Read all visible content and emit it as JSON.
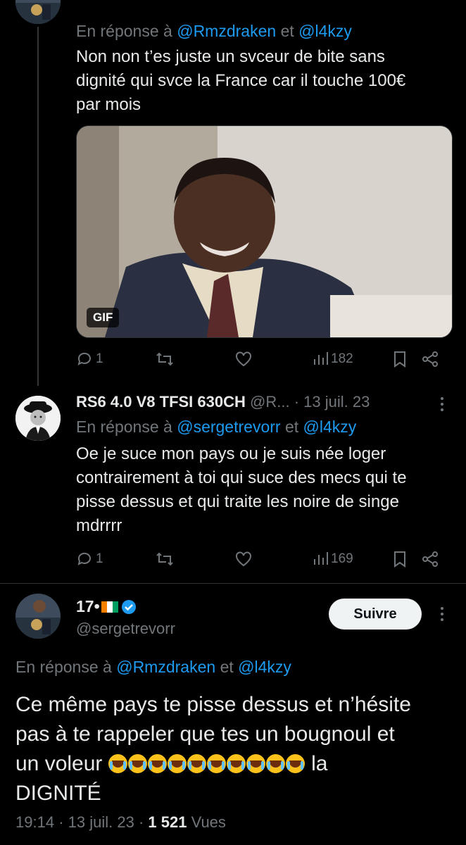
{
  "reply1": {
    "reply_prefix": "En réponse à",
    "mention1": "@Rmzdraken",
    "joiner": "et",
    "mention2": "@l4kzy",
    "text_lines": [
      "Non non t’es juste un svceur de bite sans",
      "dignité qui svce la France car il touche 100€",
      "par mois"
    ],
    "gif_label": "GIF",
    "replies": "1",
    "views": "182"
  },
  "reply2": {
    "name": "RS6 4.0 V8 TFSI 630CH",
    "handle": "@R...",
    "date": "· 13 juil. 23",
    "reply_prefix": "En réponse à",
    "mention1": "@sergetrevorr",
    "joiner": "et",
    "mention2": "@l4kzy",
    "text_lines": [
      "Oe je suce mon pays ou je suis née loger",
      "contrairement à toi qui suce des mecs qui te",
      "pisse dessus et qui traite les noire de singe",
      "mdrrrr"
    ],
    "replies": "1",
    "views": "169"
  },
  "main_tweet": {
    "name": "17•",
    "handle": "@sergetrevorr",
    "follow_label": "Suivre",
    "reply_prefix": "En réponse à",
    "mention1": "@Rmzdraken",
    "joiner": "et",
    "mention2": "@l4kzy",
    "line1": "Ce même pays te pisse dessus et n’hésite",
    "line2": "pas à te rappeler que tes un bougnoul et",
    "line3_start": "un voleur",
    "line3_end": "la",
    "line4": "DIGNITÉ",
    "emoji_name": "loudly-crying-face",
    "emoji_count": 10,
    "time": "19:14",
    "date": "13 juil. 23",
    "views_count": "1 521",
    "views_label": "Vues"
  },
  "colors": {
    "background": "#000000",
    "text": "#e7e9ea",
    "secondary": "#71767b",
    "link": "#1d9bf0",
    "verified": "#1d9bf0"
  }
}
